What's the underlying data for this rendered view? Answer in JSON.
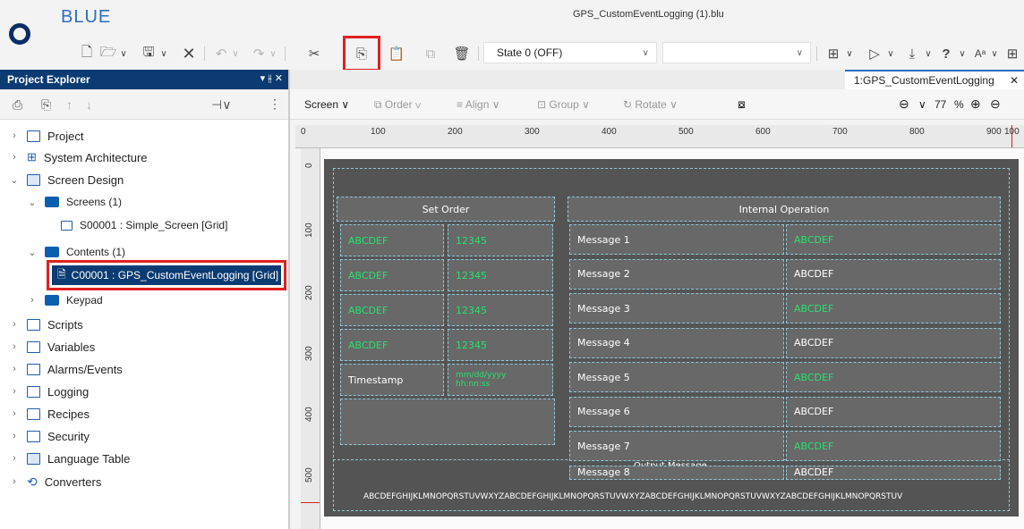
{
  "app": {
    "name": "BLUE",
    "window_title": "GPS_CustomEventLogging (1).blu"
  },
  "toolbar": {
    "state_value": "State 0 (OFF)",
    "empty_dropdown": ""
  },
  "project_explorer": {
    "title": "Project Explorer",
    "pin": "▾ ⫳ ✕",
    "items": [
      {
        "label": "Project"
      },
      {
        "label": "System Architecture"
      },
      {
        "label": "Screen Design"
      },
      {
        "label": "Screens (1)"
      },
      {
        "label": "S00001 : Simple_Screen [Grid]"
      },
      {
        "label": "Contents (1)"
      },
      {
        "label": "C00001 : GPS_CustomEventLogging [Grid]"
      },
      {
        "label": "Keypad"
      },
      {
        "label": "Scripts"
      },
      {
        "label": "Variables"
      },
      {
        "label": "Alarms/Events"
      },
      {
        "label": "Logging"
      },
      {
        "label": "Recipes"
      },
      {
        "label": "Security"
      },
      {
        "label": "Language Table"
      },
      {
        "label": "Converters"
      }
    ]
  },
  "editor": {
    "tab_label": "1:GPS_CustomEventLogging",
    "tools": {
      "screen": "Screen",
      "order": "Order",
      "align": "Align",
      "group": "Group",
      "rotate": "Rotate",
      "zoom": "77",
      "percent": "%"
    },
    "ruler_h": [
      "0",
      "100",
      "200",
      "300",
      "400",
      "500",
      "600",
      "700",
      "800",
      "900",
      "100"
    ],
    "ruler_v": [
      "0",
      "100",
      "200",
      "300",
      "400",
      "500"
    ]
  },
  "screen": {
    "set_order_title": "Set Order",
    "internal_operation_title": "Internal Operation",
    "set_order_rows": [
      {
        "a": "ABCDEF",
        "b": "12345"
      },
      {
        "a": "ABCDEF",
        "b": "12345"
      },
      {
        "a": "ABCDEF",
        "b": "12345"
      },
      {
        "a": "ABCDEF",
        "b": "12345"
      }
    ],
    "timestamp_label": "Timestamp",
    "timestamp_format": "mm/dd/yyyy\nhh:nn:ss",
    "messages": [
      {
        "label": "Message 1",
        "value": "ABCDEF",
        "green": true
      },
      {
        "label": "Message 2",
        "value": "ABCDEF",
        "green": false
      },
      {
        "label": "Message 3",
        "value": "ABCDEF",
        "green": true
      },
      {
        "label": "Message 4",
        "value": "ABCDEF",
        "green": false
      },
      {
        "label": "Message 5",
        "value": "ABCDEF",
        "green": true
      },
      {
        "label": "Message 6",
        "value": "ABCDEF",
        "green": false
      },
      {
        "label": "Message 7",
        "value": "ABCDEF",
        "green": true
      },
      {
        "label": "Message 8",
        "value": "ABCDEF",
        "green": false
      }
    ],
    "output_message_title": "Output Message",
    "output_message_text": "ABCDEFGHIJKLMNOPQRSTUVWXYZABCDEFGHIJKLMNOPQRSTUVWXYZABCDEFGHIJKLMNOPQRSTUVWXYZABCDEFGHIJKLMNOPQRSTUV"
  },
  "colors": {
    "accent": "#2b6cc4",
    "panel_header": "#0b3b72",
    "highlight": "#e02020",
    "canvas": "#545454",
    "cell": "#686868",
    "green_text": "#28e070"
  }
}
